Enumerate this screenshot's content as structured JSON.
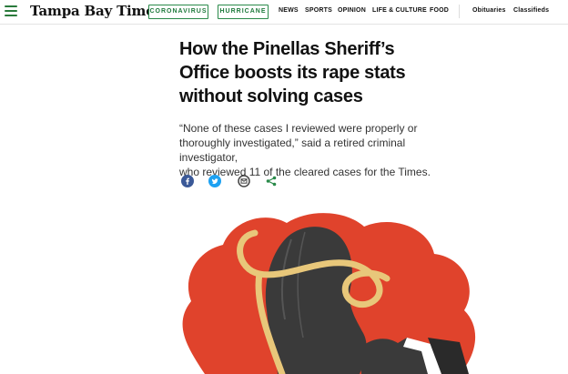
{
  "header": {
    "logo": "Tampa Bay Times",
    "pills": [
      "CORONAVIRUS",
      "HURRICANE"
    ],
    "nav": [
      "NEWS",
      "SPORTS",
      "OPINION",
      "LIFE & CULTURE",
      "FOOD"
    ],
    "right_nav": [
      "Obituaries",
      "Classifieds"
    ]
  },
  "article": {
    "headline_lines": [
      "How the Pinellas Sheriff’s",
      "Office boosts its rape stats",
      "without solving cases"
    ],
    "dek_lines": [
      "“None of these cases I reviewed were properly or",
      "thoroughly investigated,” said a retired criminal investigator,",
      "who reviewed 11 of the cleared cases for the Times."
    ]
  },
  "share_icons": [
    "facebook-icon",
    "twitter-icon",
    "email-icon",
    "share-icon"
  ],
  "colors": {
    "accent_green": "#2a8a4a",
    "facebook": "#3b5998",
    "twitter": "#1da1f2",
    "illustration_red": "#e0432c",
    "ribbon": "#e8c77a",
    "figure": "#3a3a3a"
  }
}
